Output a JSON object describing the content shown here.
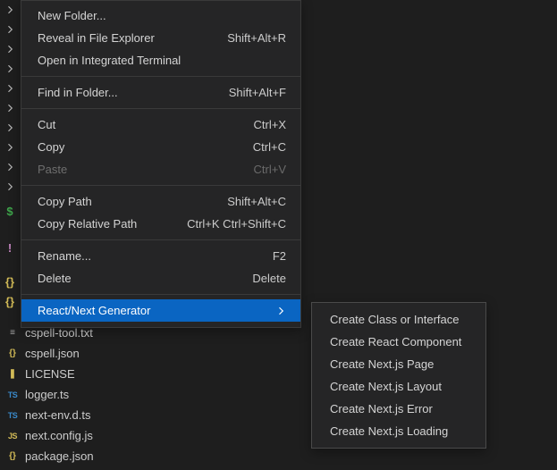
{
  "gutter": {
    "rows": 10
  },
  "context_menu": {
    "groups": [
      [
        {
          "id": "new-folder",
          "label": "New Folder...",
          "shortcut": ""
        },
        {
          "id": "reveal-explorer",
          "label": "Reveal in File Explorer",
          "shortcut": "Shift+Alt+R"
        },
        {
          "id": "open-terminal",
          "label": "Open in Integrated Terminal",
          "shortcut": ""
        }
      ],
      [
        {
          "id": "find-in-folder",
          "label": "Find in Folder...",
          "shortcut": "Shift+Alt+F"
        }
      ],
      [
        {
          "id": "cut",
          "label": "Cut",
          "shortcut": "Ctrl+X"
        },
        {
          "id": "copy",
          "label": "Copy",
          "shortcut": "Ctrl+C"
        },
        {
          "id": "paste",
          "label": "Paste",
          "shortcut": "Ctrl+V",
          "disabled": true
        }
      ],
      [
        {
          "id": "copy-path",
          "label": "Copy Path",
          "shortcut": "Shift+Alt+C"
        },
        {
          "id": "copy-rel-path",
          "label": "Copy Relative Path",
          "shortcut": "Ctrl+K Ctrl+Shift+C"
        }
      ],
      [
        {
          "id": "rename",
          "label": "Rename...",
          "shortcut": "F2"
        },
        {
          "id": "delete",
          "label": "Delete",
          "shortcut": "Delete"
        }
      ],
      [
        {
          "id": "react-next",
          "label": "React/Next Generator",
          "submenu": true,
          "highlight": true
        }
      ]
    ]
  },
  "submenu": {
    "items": [
      {
        "id": "create-class",
        "label": "Create Class or Interface"
      },
      {
        "id": "create-react-component",
        "label": "Create React Component"
      },
      {
        "id": "create-next-page",
        "label": "Create Next.js Page"
      },
      {
        "id": "create-next-layout",
        "label": "Create Next.js Layout"
      },
      {
        "id": "create-next-error",
        "label": "Create Next.js Error"
      },
      {
        "id": "create-next-loading",
        "label": "Create Next.js Loading"
      }
    ]
  },
  "files": [
    {
      "id": "cspell-tool",
      "name": "cspell-tool.txt",
      "iconText": "≡",
      "iconClass": "ic-txt"
    },
    {
      "id": "cspell-json",
      "name": "cspell.json",
      "iconText": "{}",
      "iconClass": "ic-brace"
    },
    {
      "id": "license",
      "name": "LICENSE",
      "iconText": "❚",
      "iconClass": "ic-lic"
    },
    {
      "id": "logger",
      "name": "logger.ts",
      "iconText": "TS",
      "iconClass": "ic-ts"
    },
    {
      "id": "next-env",
      "name": "next-env.d.ts",
      "iconText": "TS",
      "iconClass": "ic-ts"
    },
    {
      "id": "next-config",
      "name": "next.config.js",
      "iconText": "JS",
      "iconClass": "ic-js"
    },
    {
      "id": "package-json",
      "name": "package.json",
      "iconText": "{}",
      "iconClass": "ic-brace"
    }
  ],
  "left_icons_extra": [
    {
      "id": "dollar",
      "text": "$",
      "class": "ic-dollar"
    },
    {
      "id": "excl",
      "text": "!",
      "class": "ic-excl"
    },
    {
      "id": "brace1",
      "text": "{}",
      "class": "ic-brace"
    },
    {
      "id": "brace2",
      "text": "{}",
      "class": "ic-brace"
    }
  ]
}
